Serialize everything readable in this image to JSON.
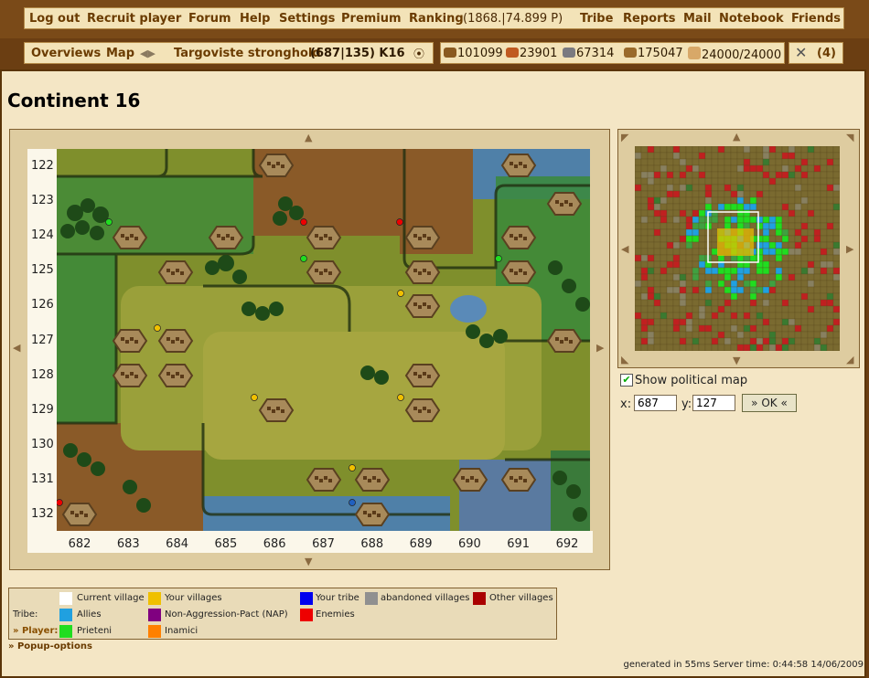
{
  "menu": {
    "items": [
      "Log out",
      "Recruit player",
      "Forum",
      "Help",
      "Settings",
      "Premium",
      "Ranking",
      "Tribe",
      "Reports",
      "Mail",
      "Notebook",
      "Friends"
    ],
    "ranking_value": "(1868.|74.899 P)"
  },
  "village_bar": {
    "overviews": "Overviews",
    "map": "Map",
    "arrows": "◀▶",
    "village_name": "Targoviste stronghold",
    "coords": "(687|135) K16"
  },
  "resources": {
    "wood": "101099",
    "clay": "23901",
    "iron": "67314",
    "storage": "175047",
    "population": "24000/24000",
    "attacks": "(4)"
  },
  "page_title": "Continent 16",
  "map": {
    "y_labels": [
      "122",
      "123",
      "124",
      "125",
      "126",
      "127",
      "128",
      "129",
      "130",
      "131",
      "132"
    ],
    "x_labels": [
      "682",
      "683",
      "684",
      "685",
      "686",
      "687",
      "688",
      "689",
      "690",
      "691",
      "692"
    ],
    "colors": {
      "grass": "#7a8a2a",
      "forest": "#2e5a1e",
      "water": "#4a78b0"
    }
  },
  "minimap": {
    "show_political_label": "Show political map",
    "show_political_checked": true
  },
  "jump": {
    "x_label": "x:",
    "y_label": "y:",
    "x_value": "687",
    "y_value": "127",
    "ok_label": "» OK «"
  },
  "legend": {
    "current_village": "Current village",
    "your_villages": "Your villages",
    "your_tribe": "Your tribe",
    "abandoned_villages": "abandoned villages",
    "other_villages": "Other villages",
    "tribe_label": "Tribe:",
    "allies": "Allies",
    "nap": "Non-Aggression-Pact (NAP)",
    "enemies": "Enemies",
    "player_label": "» Player:",
    "prieteni": "Prieteni",
    "inamici": "Inamici",
    "colors": {
      "current": "#ffffff",
      "your": "#f0c000",
      "tribe": "#0000ee",
      "abandoned": "#909090",
      "other": "#aa0000",
      "allies": "#20a0e0",
      "nap": "#800080",
      "enemies": "#ee0000",
      "prieteni": "#20dd20",
      "inamici": "#ff8000"
    }
  },
  "popup_options": "» Popup-options",
  "footer": "generated in 55ms Server time: 0:44:58 14/06/2009"
}
